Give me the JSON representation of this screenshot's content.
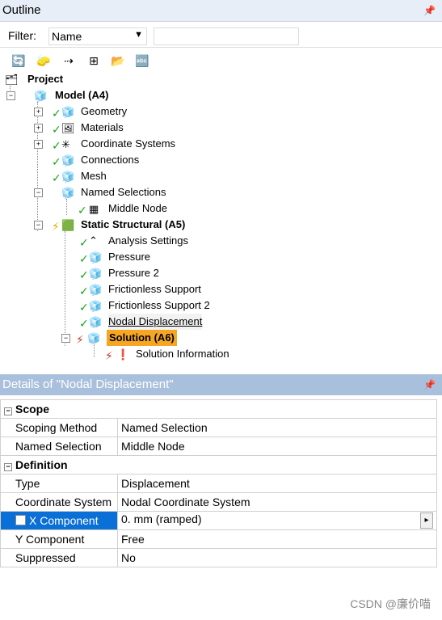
{
  "outline": {
    "title": "Outline",
    "pin": "ᵖ",
    "filter_label": "Filter:",
    "filter_value": "Name",
    "filter_text": ""
  },
  "toolbar": [
    "refresh-icon",
    "clear-icon",
    "tree-icon",
    "expand-all-icon",
    "collapse-icon",
    "sort-az-icon"
  ],
  "tree": {
    "project": "Project",
    "model": "Model (A4)",
    "geometry": "Geometry",
    "materials": "Materials",
    "coord": "Coordinate Systems",
    "connections": "Connections",
    "mesh": "Mesh",
    "named_sel": "Named Selections",
    "middle_node": "Middle Node",
    "static": "Static Structural (A5)",
    "analysis": "Analysis Settings",
    "pressure": "Pressure",
    "pressure2": "Pressure 2",
    "fs1": "Frictionless Support",
    "fs2": "Frictionless Support 2",
    "nodal": "Nodal Displacement",
    "solution": "Solution (A6)",
    "sol_info": "Solution Information"
  },
  "details": {
    "title": "Details of \"Nodal Displacement\"",
    "pin": "ᵖ",
    "scope": "Scope",
    "scoping_method_k": "Scoping Method",
    "scoping_method_v": "Named Selection",
    "named_selection_k": "Named Selection",
    "named_selection_v": "Middle Node",
    "definition": "Definition",
    "type_k": "Type",
    "type_v": "Displacement",
    "coord_k": "Coordinate System",
    "coord_v": "Nodal Coordinate System",
    "x_k": "X Component",
    "x_v": "0. mm  (ramped)",
    "y_k": "Y Component",
    "y_v": "Free",
    "supp_k": "Suppressed",
    "supp_v": "No"
  },
  "watermark": "CSDN @廉价喵"
}
